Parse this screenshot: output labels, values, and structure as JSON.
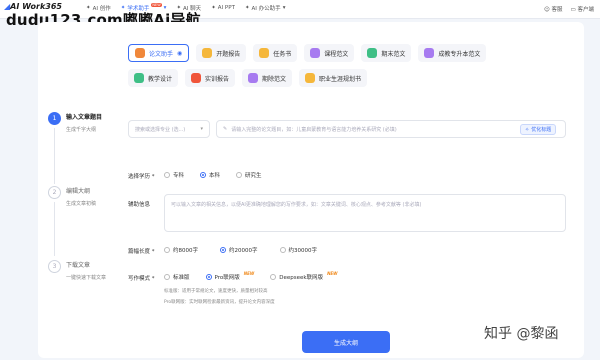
{
  "app": {
    "logo": "AI Work365",
    "watermark": "dudu123.com嘟嘟Ai导航"
  },
  "nav": [
    {
      "label": "AI 创作",
      "active": false
    },
    {
      "label": "学术助手",
      "active": true,
      "badge": "NEW"
    },
    {
      "label": "AI 聊天",
      "active": false
    },
    {
      "label": "AI PPT",
      "active": false
    },
    {
      "label": "AI 办公助手",
      "active": false
    }
  ],
  "top_right": {
    "help": "客服",
    "client": "客户端"
  },
  "chips": [
    {
      "label": "论文助手",
      "active": true,
      "color": "#f0883a"
    },
    {
      "label": "开题报告",
      "active": false,
      "color": "#f5b73b"
    },
    {
      "label": "任务书",
      "active": false,
      "color": "#f5b73b"
    },
    {
      "label": "课程范文",
      "active": false,
      "color": "#a77bf0"
    },
    {
      "label": "期末范文",
      "active": false,
      "color": "#3fbf86"
    },
    {
      "label": "成教专升本范文",
      "active": false,
      "color": "#a77bf0"
    },
    {
      "label": "教学设计",
      "active": false,
      "color": "#3fbf86"
    },
    {
      "label": "实训报告",
      "active": false,
      "color": "#f0553a"
    },
    {
      "label": "期除范文",
      "active": false,
      "color": "#a77bf0"
    },
    {
      "label": "职业生涯规划书",
      "active": false,
      "color": "#f5b73b"
    }
  ],
  "steps": [
    {
      "num": "1",
      "title": "输入文章题目",
      "sub": "生成千字大纲",
      "active": true
    },
    {
      "num": "2",
      "title": "编辑大纲",
      "sub": "生成文章初稿",
      "active": false
    },
    {
      "num": "3",
      "title": "下载文章",
      "sub": "一键快速下载文章",
      "active": false
    }
  ],
  "form": {
    "major_placeholder": "搜索或选择专业 (选...)",
    "title_placeholder": "请输入完整的论文题目，如：儿童启蒙教育与语言能力培养关系研究 (必填)",
    "optimize_btn": "优化标题",
    "degree_label": "选择学历 *",
    "degree_options": [
      {
        "label": "专科",
        "on": false
      },
      {
        "label": "本科",
        "on": true
      },
      {
        "label": "研究生",
        "on": false
      }
    ],
    "info_label": "辅助信息",
    "info_placeholder": "可以输入文章的相关信息，以便AI更准确地理解您的写作要求，如：文章关键词、核心观点、参考文献等 (非必填)",
    "length_label": "篇幅长度 *",
    "length_options": [
      {
        "label": "约8000字",
        "on": false
      },
      {
        "label": "约20000字",
        "on": true
      },
      {
        "label": "约30000字",
        "on": false
      }
    ],
    "mode_label": "写作模式 *",
    "mode_options": [
      {
        "label": "标准版",
        "on": false,
        "tag": ""
      },
      {
        "label": "Pro联网版",
        "on": true,
        "tag": "NEW"
      },
      {
        "label": "Deepseek联网版",
        "on": false,
        "tag": "NEW"
      }
    ],
    "hint1": "标准版：适用于常规论文，速度更快，质量相对较高",
    "hint2": "Pro联网版：实时联网检索最新资讯，提升论文内容深度",
    "generate_btn": "生成大纲"
  },
  "credit": "知乎 @黎函"
}
